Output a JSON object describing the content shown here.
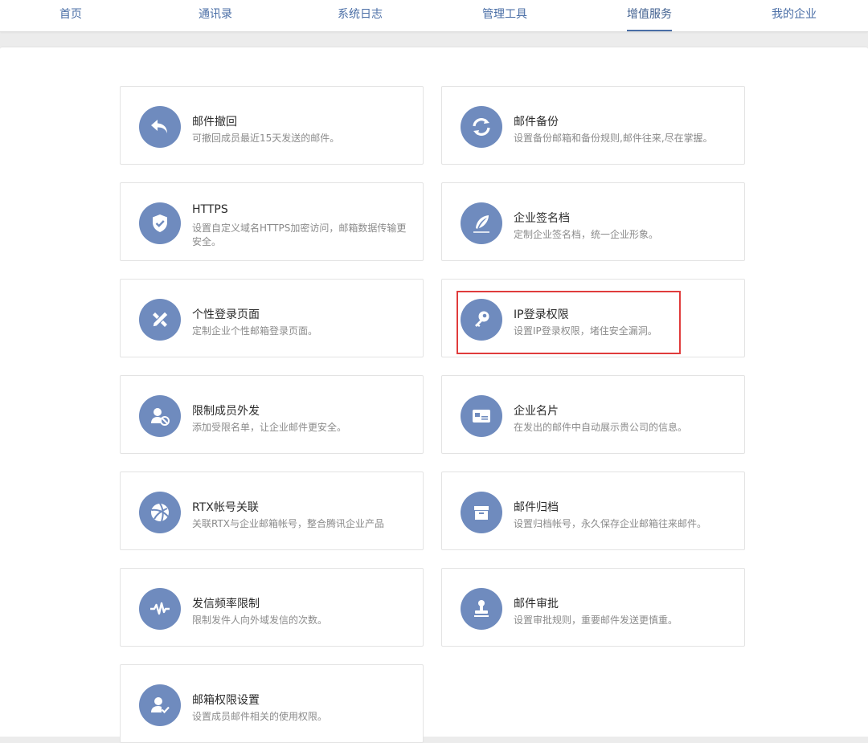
{
  "nav": {
    "items": [
      "首页",
      "通讯录",
      "系统日志",
      "管理工具",
      "增值服务",
      "我的企业"
    ],
    "active": "增值服务"
  },
  "colors": {
    "accent": "#4a6ea6",
    "icon_bg": "#6f8bbe",
    "highlight": "#e03c3c"
  },
  "services": [
    {
      "title": "邮件撤回",
      "desc": "可撤回成员最近15天发送的邮件。",
      "icon": "undo-arrow-icon"
    },
    {
      "title": "邮件备份",
      "desc": "设置备份邮箱和备份规则,邮件往来,尽在掌握。",
      "icon": "sync-icon"
    },
    {
      "title": "HTTPS",
      "desc": "设置自定义域名HTTPS加密访问，邮箱数据传输更安全。",
      "icon": "shield-check-icon"
    },
    {
      "title": "企业签名档",
      "desc": "定制企业签名档，统一企业形象。",
      "icon": "feather-pen-icon"
    },
    {
      "title": "个性登录页面",
      "desc": "定制企业个性邮箱登录页面。",
      "icon": "ruler-pencil-icon"
    },
    {
      "title": "IP登录权限",
      "desc": "设置IP登录权限，堵住安全漏洞。",
      "icon": "key-icon"
    },
    {
      "title": "限制成员外发",
      "desc": "添加受限名单，让企业邮件更安全。",
      "icon": "user-blocked-icon"
    },
    {
      "title": "企业名片",
      "desc": "在发出的邮件中自动展示贵公司的信息。",
      "icon": "business-card-icon"
    },
    {
      "title": "RTX帐号关联",
      "desc": "关联RTX与企业邮箱帐号，整合腾讯企业产品",
      "icon": "rtx-logo-icon"
    },
    {
      "title": "邮件归档",
      "desc": "设置归档帐号，永久保存企业邮箱往来邮件。",
      "icon": "archive-box-icon"
    },
    {
      "title": "发信频率限制",
      "desc": "限制发件人向外域发信的次数。",
      "icon": "pulse-icon"
    },
    {
      "title": "邮件审批",
      "desc": "设置审批规则，重要邮件发送更慎重。",
      "icon": "approval-stamp-icon"
    },
    {
      "title": "邮箱权限设置",
      "desc": "设置成员邮件相关的使用权限。",
      "icon": "user-check-icon"
    }
  ]
}
